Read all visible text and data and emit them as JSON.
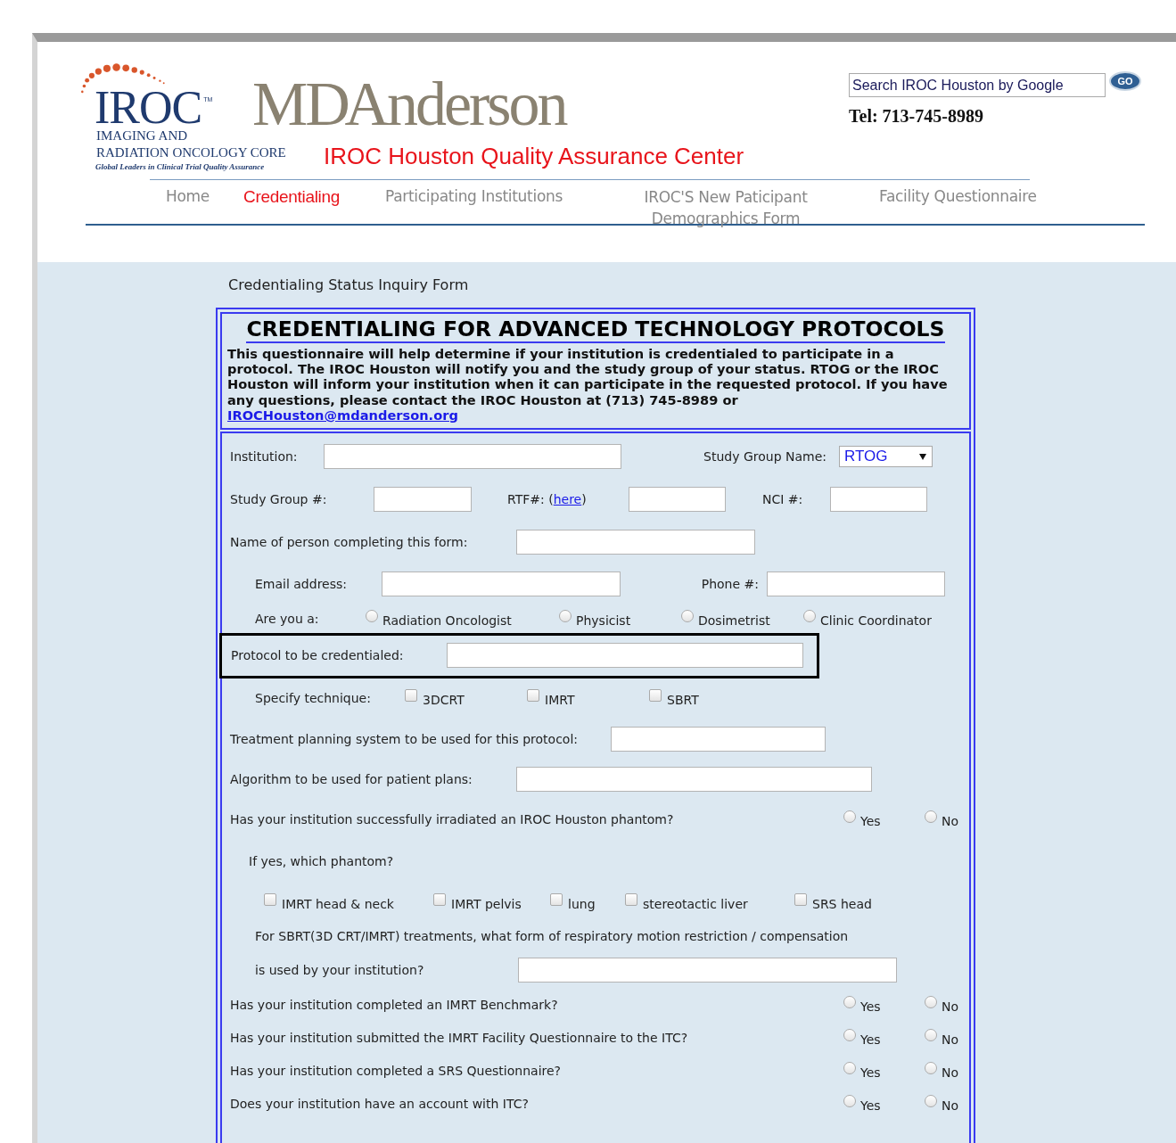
{
  "header": {
    "logo": {
      "mark": "IROC",
      "tm": "TM",
      "line_1": "IMAGING AND",
      "line_2": "RADIATION ONCOLOGY CORE",
      "tagline": "Global Leaders in Clinical Trial Quality Assurance"
    },
    "brand": "MD Anderson",
    "subtitle": "IROC Houston Quality Assurance Center",
    "search": {
      "value": "Search IROC Houston by Google",
      "button": "GO"
    },
    "phone": "Tel: 713-745-8989"
  },
  "nav": [
    {
      "label": "Home",
      "selected": false
    },
    {
      "label": "Credentialing",
      "selected": true
    },
    {
      "label": "Participating Institutions",
      "selected": false
    },
    {
      "label": "IROC'S New Paticipant Demographics Form",
      "selected": false
    },
    {
      "label": "Facility Questionnaire",
      "selected": false
    }
  ],
  "page_title": "Credentialing Status Inquiry Form",
  "form": {
    "heading": "CREDENTIALING FOR ADVANCED TECHNOLOGY PROTOCOLS",
    "intro": "This questionnaire will help determine if your institution is credentialed to participate in a protocol. The IROC Houston will notify you and the study group of your status. RTOG or the IROC Houston will inform your institution when it can participate in the requested protocol. If you have any questions, please contact the IROC Houston at (713) 745-8989 or",
    "email": "IROCHouston@mdanderson.org",
    "rows": [
      {
        "highlighted": false,
        "items": [
          {
            "kind": "label",
            "text": "Institution:"
          },
          {
            "kind": "input"
          },
          {
            "kind": "label",
            "text": "Study Group Name:"
          },
          {
            "kind": "select",
            "value": "RTOG"
          }
        ]
      },
      {
        "highlighted": false,
        "items": [
          {
            "kind": "label",
            "text": "Study Group #:"
          },
          {
            "kind": "input"
          },
          {
            "kind": "link_label",
            "before": "RTF#: (",
            "link": "here",
            "after": ")"
          },
          {
            "kind": "input"
          },
          {
            "kind": "label",
            "text": "NCI #:"
          },
          {
            "kind": "input"
          }
        ]
      },
      {
        "highlighted": false,
        "items": [
          {
            "kind": "label",
            "text": "Name of person completing this form:"
          },
          {
            "kind": "input"
          }
        ]
      },
      {
        "highlighted": false,
        "items": [
          {
            "kind": "label",
            "text": "Email address:"
          },
          {
            "kind": "input"
          },
          {
            "kind": "label",
            "text": "Phone #:"
          },
          {
            "kind": "input"
          }
        ]
      },
      {
        "highlighted": false,
        "items": [
          {
            "kind": "label",
            "text": "Are you a:"
          },
          {
            "kind": "radio",
            "label": "Radiation Oncologist",
            "selected": false
          },
          {
            "kind": "radio",
            "label": "Physicist",
            "selected": false
          },
          {
            "kind": "radio",
            "label": "Dosimetrist",
            "selected": false
          },
          {
            "kind": "radio",
            "label": "Clinic Coordinator",
            "selected": false
          }
        ]
      },
      {
        "highlighted": true,
        "items": [
          {
            "kind": "label",
            "text": "Protocol to be credentialed:"
          },
          {
            "kind": "input"
          }
        ]
      },
      {
        "highlighted": false,
        "items": [
          {
            "kind": "label",
            "text": "Specify technique:"
          },
          {
            "kind": "checkbox",
            "label": "3DCRT",
            "checked": false
          },
          {
            "kind": "checkbox",
            "label": "IMRT",
            "checked": false
          },
          {
            "kind": "checkbox",
            "label": "SBRT",
            "checked": false
          }
        ]
      },
      {
        "highlighted": false,
        "items": [
          {
            "kind": "label",
            "text": "Treatment planning system to be used for this protocol:"
          },
          {
            "kind": "input"
          }
        ]
      },
      {
        "highlighted": false,
        "items": [
          {
            "kind": "label",
            "text": "Algorithm to be used for patient plans:"
          },
          {
            "kind": "input"
          }
        ]
      },
      {
        "highlighted": false,
        "items": [
          {
            "kind": "label",
            "text": "Has your institution successfully irradiated an IROC Houston phantom?"
          },
          {
            "kind": "radio",
            "label": "Yes",
            "selected": false
          },
          {
            "kind": "radio",
            "label": "No",
            "selected": false
          }
        ]
      },
      {
        "highlighted": false,
        "items": [
          {
            "kind": "label",
            "text": "If yes, which phantom?"
          }
        ]
      },
      {
        "highlighted": false,
        "items": [
          {
            "kind": "checkbox",
            "label": "IMRT head & neck",
            "checked": false
          },
          {
            "kind": "checkbox",
            "label": "IMRT pelvis",
            "checked": false
          },
          {
            "kind": "checkbox",
            "label": "lung",
            "checked": false
          },
          {
            "kind": "checkbox",
            "label": "stereotactic liver",
            "checked": false
          },
          {
            "kind": "checkbox",
            "label": "SRS head",
            "checked": false
          }
        ]
      },
      {
        "highlighted": false,
        "items": [
          {
            "kind": "label",
            "text": "For SBRT(3D CRT/IMRT) treatments, what form of respiratory motion restriction / compensation"
          }
        ]
      },
      {
        "highlighted": false,
        "items": [
          {
            "kind": "label",
            "text": "is used by your institution?"
          },
          {
            "kind": "input"
          }
        ]
      },
      {
        "highlighted": false,
        "items": [
          {
            "kind": "label",
            "text": "Has your institution completed an IMRT Benchmark?"
          },
          {
            "kind": "radio",
            "label": "Yes",
            "selected": false
          },
          {
            "kind": "radio",
            "label": "No",
            "selected": false
          }
        ]
      },
      {
        "highlighted": false,
        "items": [
          {
            "kind": "label",
            "text": "Has your institution submitted the IMRT Facility Questionnaire to the ITC?"
          },
          {
            "kind": "radio",
            "label": "Yes",
            "selected": false
          },
          {
            "kind": "radio",
            "label": "No",
            "selected": false
          }
        ]
      },
      {
        "highlighted": false,
        "items": [
          {
            "kind": "label",
            "text": "Has your institution completed a SRS Questionnaire?"
          },
          {
            "kind": "radio",
            "label": "Yes",
            "selected": false
          },
          {
            "kind": "radio",
            "label": "No",
            "selected": false
          }
        ]
      },
      {
        "highlighted": false,
        "items": [
          {
            "kind": "label",
            "text": "Does your institution have an account with ITC?"
          },
          {
            "kind": "radio",
            "label": "Yes",
            "selected": false
          },
          {
            "kind": "radio",
            "label": "No",
            "selected": false
          }
        ]
      }
    ]
  }
}
